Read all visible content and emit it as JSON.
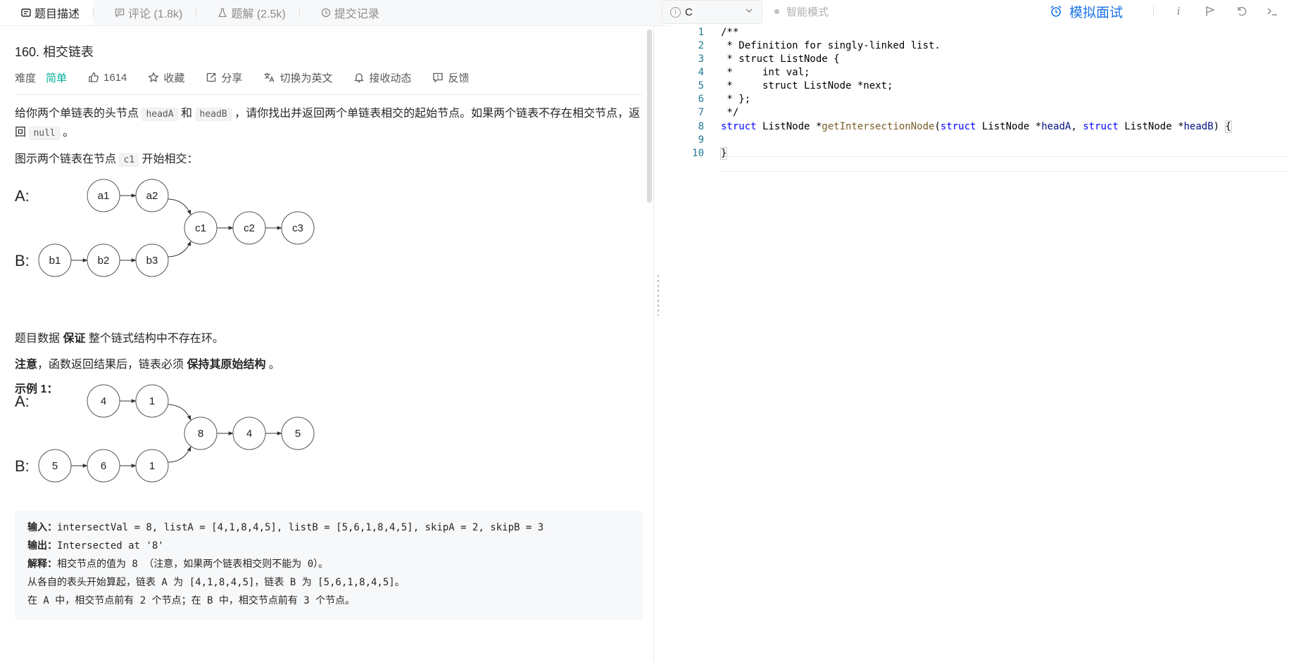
{
  "tabs": [
    {
      "label": "题目描述",
      "icon": "description-icon"
    },
    {
      "label": "评论 (1.8k)",
      "icon": "comment-icon"
    },
    {
      "label": "题解 (2.5k)",
      "icon": "flask-icon"
    },
    {
      "label": "提交记录",
      "icon": "clock-icon"
    }
  ],
  "problem": {
    "title": "160. 相交链表",
    "difficulty_label": "难度",
    "difficulty_value": "简单",
    "likes": "1614",
    "favorite": "收藏",
    "share": "分享",
    "switch_lang": "切换为英文",
    "notify": "接收动态",
    "feedback": "反馈"
  },
  "desc": {
    "p1a": "给你两个单链表的头节点 ",
    "codeA": "headA",
    "p1b": " 和 ",
    "codeB": "headB",
    "p1c": " ，请你找出并返回两个单链表相交的起始节点。如果两个链表不存在相交节点，返回 ",
    "codeNull": "null",
    "p1d": " 。",
    "p2a": "图示两个链表在节点 ",
    "codeC1": "c1",
    "p2b": " 开始相交：",
    "p3a": "题目数据 ",
    "p3b": "保证",
    "p3c": " 整个链式结构中不存在环。",
    "p4a": "注意",
    "p4b": "，函数返回结果后，链表必须 ",
    "p4c": "保持其原始结构",
    "p4d": " 。",
    "example_title": "示例 1："
  },
  "diagram1": {
    "a_label": "A:",
    "b_label": "B:",
    "a": [
      "a1",
      "a2"
    ],
    "b": [
      "b1",
      "b2",
      "b3"
    ],
    "c": [
      "c1",
      "c2",
      "c3"
    ]
  },
  "diagram2": {
    "a_label": "A:",
    "b_label": "B:",
    "a": [
      "4",
      "1"
    ],
    "b": [
      "5",
      "6",
      "1"
    ],
    "c": [
      "8",
      "4",
      "5"
    ]
  },
  "example": {
    "in_label": "输入：",
    "in_text": "intersectVal = 8, listA = [4,1,8,4,5], listB = [5,6,1,8,4,5], skipA = 2, skipB = 3",
    "out_label": "输出：",
    "out_text": "Intersected at '8'",
    "exp_label": "解释：",
    "exp_text": "相交节点的值为 8 （注意，如果两个链表相交则不能为 0）。",
    "line4": "从各自的表头开始算起，链表 A 为 [4,1,8,4,5]，链表 B 为 [5,6,1,8,4,5]。",
    "line5": "在 A 中，相交节点前有 2 个节点；在 B 中，相交节点前有 3 个节点。"
  },
  "editor_toolbar": {
    "language": "C",
    "smart_mode": "智能模式",
    "mock_interview": "模拟面试"
  },
  "code_lines": [
    "/**",
    " * Definition for singly-linked list.",
    " * struct ListNode {",
    " *     int val;",
    " *     struct ListNode *next;",
    " * };",
    " */",
    "struct ListNode *getIntersectionNode(struct ListNode *headA, struct ListNode *headB) {",
    "",
    "}"
  ],
  "colors": {
    "accent": "#1a73e8",
    "easy": "#00af9b",
    "comment": "#008000",
    "keyword": "#0000ff"
  }
}
